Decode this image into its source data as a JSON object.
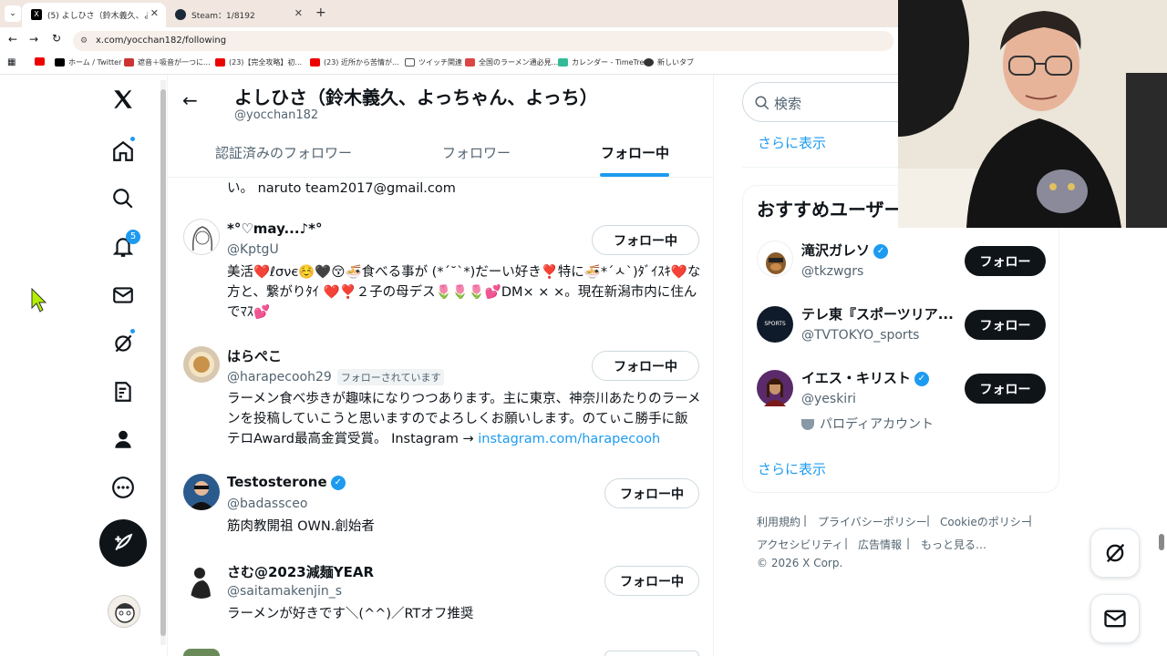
{
  "browser": {
    "tabs": [
      {
        "title": "(5) よしひさ（鈴木義久、よっちゃん、",
        "active": true
      },
      {
        "title": "Steam：1/8192",
        "active": false
      }
    ],
    "url": "x.com/yocchan182/following",
    "bookmarks": [
      "ホーム / Twitter",
      "遮音＋吸音が一つに...",
      "(23)【完全攻略】初...",
      "(23) 近所から苦情が...",
      "ツイッチ関連",
      "全国のラーメン通必見...",
      "カレンダー - TimeTree",
      "新しいタブ"
    ]
  },
  "nav": {
    "notifications_count": "5",
    "icons": [
      "x-logo-icon",
      "home-icon",
      "explore-icon",
      "notifications-icon",
      "messages-icon",
      "grok-icon",
      "lists-icon",
      "profile-icon",
      "more-icon"
    ]
  },
  "profile": {
    "name": "よしひさ（鈴木義久、よっちゃん、よっち）",
    "handle": "@yocchan182"
  },
  "tabs": [
    "認証済みのフォロワー",
    "フォロワー",
    "フォロー中"
  ],
  "partial_bio": "い。 naruto team2017@gmail.com",
  "users": [
    {
      "name": "*°♡may...♪*°",
      "handle": "@KptgU",
      "follows_you": "",
      "verified": false,
      "button": "フォロー中",
      "bio": "美活❤️ℓσνє☺️🖤😚🍜食べる事が (*´˘`*)だーい好き❣️特に🍜*´ㅅ`)ﾀﾞｲｽｷ❤️な方と、繋がりﾀｲ ❤️❣️２子の母デス🌷🌷🌷💕DM× × ×。現在新潟市内に住んでﾏｽ💕"
    },
    {
      "name": "はらぺこ",
      "handle": "@harapecooh29",
      "follows_you": "フォローされています",
      "verified": false,
      "button": "フォロー中",
      "bio": "ラーメン食べ歩きが趣味になりつつあります。主に東京、神奈川あたりのラーメンを投稿していこうと思いますのでよろしくお願いします。のてぃこ勝手に飯テロAward最高金賞受賞。 Instagram → ",
      "bio_link": "instagram.com/harapecooh"
    },
    {
      "name": "Testosterone",
      "handle": "@badassceo",
      "follows_you": "",
      "verified": true,
      "button": "フォロー中",
      "bio": "筋肉教開祖 OWN.創始者"
    },
    {
      "name": "さむ@2023減麺YEAR",
      "handle": "@saitamakenjin_s",
      "follows_you": "",
      "verified": false,
      "button": "フォロー中",
      "bio": "ラーメンが好きです＼(^^)／RTオフ推奨"
    }
  ],
  "search": {
    "placeholder": "検索"
  },
  "show_more": "さらに表示",
  "recommended": {
    "title": "おすすめユーザー",
    "users": [
      {
        "name": "滝沢ガレソ",
        "handle": "@tkzwgrs",
        "verified": true,
        "button": "フォロー"
      },
      {
        "name": "テレ東『スポーツリア...",
        "handle": "@TVTOKYO_sports",
        "verified": false,
        "button": "フォロー"
      },
      {
        "name": "イエス・キリスト",
        "handle": "@yeskiri",
        "verified": true,
        "button": "フォロー",
        "note": "パロディアカウント"
      }
    ],
    "show_more": "さらに表示"
  },
  "footer": {
    "links": [
      "利用規約",
      "プライバシーポリシー",
      "Cookieのポリシー",
      "アクセシビリティ",
      "広告情報",
      "もっと見る…"
    ],
    "copyright": "© 2026 X Corp."
  },
  "colors": {
    "accent": "#1d9bf0",
    "text": "#0f1419",
    "muted": "#536471",
    "dark_button": "#0f1419"
  }
}
